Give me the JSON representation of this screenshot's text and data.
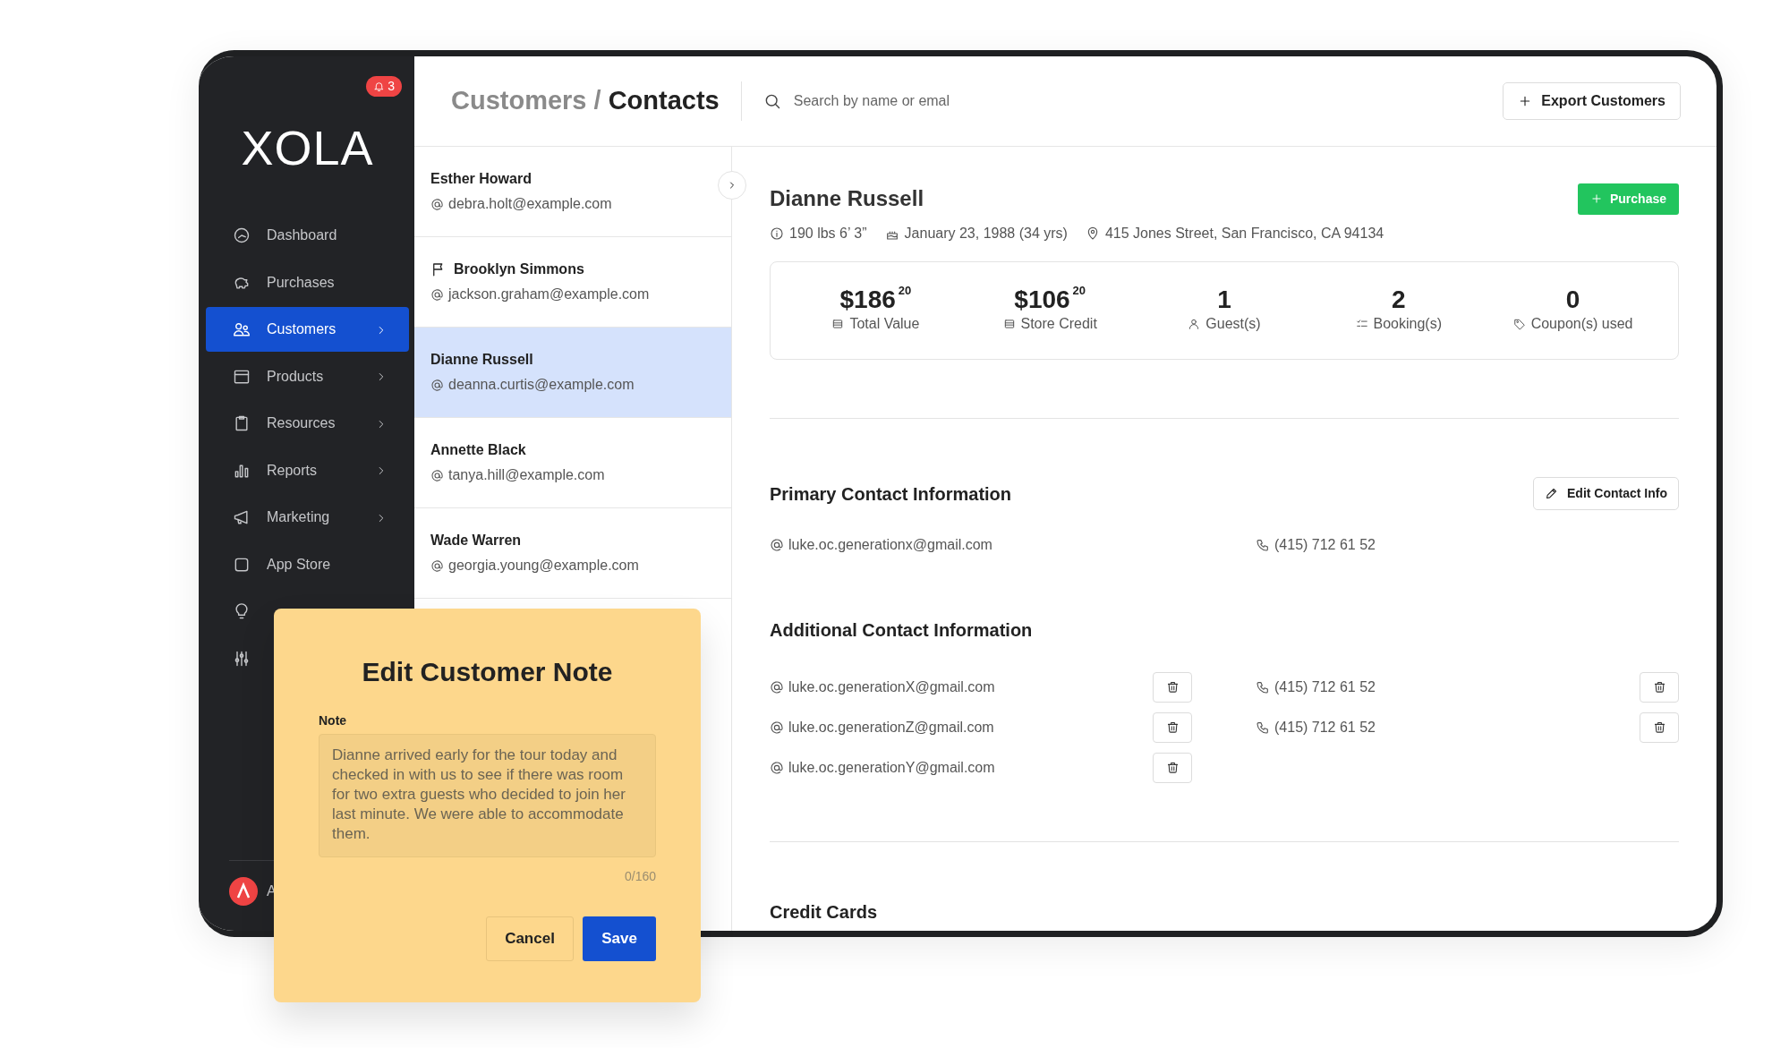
{
  "sidebar": {
    "notification_count": "3",
    "logo": "XOLA",
    "items": [
      {
        "label": "Dashboard",
        "selected": false,
        "has_submenu": false
      },
      {
        "label": "Purchases",
        "selected": false,
        "has_submenu": false
      },
      {
        "label": "Customers",
        "selected": true,
        "has_submenu": true
      },
      {
        "label": "Products",
        "selected": false,
        "has_submenu": true
      },
      {
        "label": "Resources",
        "selected": false,
        "has_submenu": true
      },
      {
        "label": "Reports",
        "selected": false,
        "has_submenu": true
      },
      {
        "label": "Marketing",
        "selected": false,
        "has_submenu": true
      },
      {
        "label": "App Store",
        "selected": false,
        "has_submenu": false
      },
      {
        "selected": false
      },
      {
        "selected": false
      }
    ],
    "user": {
      "name": "A"
    }
  },
  "header": {
    "breadcrumb_parent": "Customers /",
    "breadcrumb_current": "Contacts",
    "search": {
      "placeholder": "Search by name or emal"
    },
    "export_button": "Export Customers"
  },
  "contacts": [
    {
      "name": "Esther Howard",
      "email": "debra.holt@example.com",
      "flagged": false,
      "selected": false
    },
    {
      "name": "Brooklyn Simmons",
      "email": "jackson.graham@example.com",
      "flagged": true,
      "selected": false
    },
    {
      "name": "Dianne Russell",
      "email": "deanna.curtis@example.com",
      "flagged": false,
      "selected": true
    },
    {
      "name": "Annette Black",
      "email": "tanya.hill@example.com",
      "flagged": false,
      "selected": false
    },
    {
      "name": "Wade Warren",
      "email": "georgia.young@example.com",
      "flagged": false,
      "selected": false
    }
  ],
  "customer": {
    "name": "Dianne Russell",
    "purchase_button": "Purchase",
    "height_weight": "190 lbs 6’ 3”",
    "birthday": "January 23, 1988 (34 yrs)",
    "address": "415 Jones Street, San Francisco, CA 94134",
    "stats": [
      {
        "value": "$186$^{20}$",
        "label": "Total Value"
      },
      {
        "value": "$106$^{20}$",
        "label": "Store Credit"
      },
      {
        "value": "1",
        "label": "Guest(s)"
      },
      {
        "value": "2",
        "label": "Booking(s)"
      },
      {
        "value": "0",
        "label": "Coupon(s) used"
      }
    ]
  },
  "primary_contact": {
    "title": "Primary Contact Information",
    "edit_button": "Edit Contact Info",
    "email": "luke.oc.generationx@gmail.com",
    "phone": "(415) 712 61 52"
  },
  "additional_contact": {
    "title": "Additional Contact Information",
    "emails": [
      "luke.oc.generationX@gmail.com",
      "luke.oc.generationZ@gmail.com",
      "luke.oc.generationY@gmail.com"
    ],
    "phones": [
      "(415) 712 61 52",
      "(415) 712 61 52"
    ]
  },
  "credit_cards": {
    "title": "Credit Cards"
  },
  "note_dialog": {
    "title": "Edit Customer Note",
    "label": "Note",
    "text": "Dianne arrived early for the tour today and checked in with us to see if there was room for two extra guests who decided to join her last minute. We were able to accommodate them.",
    "counter": "0/160",
    "cancel": "Cancel",
    "save": "Save"
  }
}
